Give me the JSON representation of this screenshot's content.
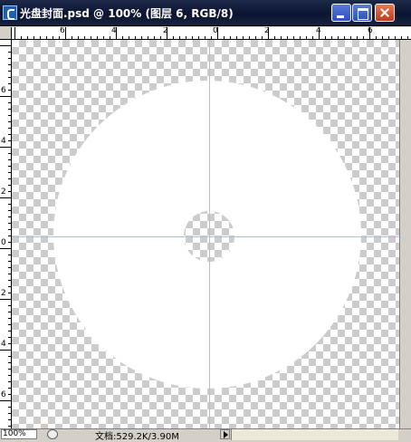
{
  "window": {
    "title": "光盘封面.psd @ 100% (图层 6, RGB/8)",
    "controls": [
      "minimize-icon",
      "maximize-icon",
      "close-icon"
    ]
  },
  "rulers": {
    "horizontal_labels": [
      "6",
      "4",
      "2",
      "0",
      "2",
      "4",
      "6"
    ],
    "vertical_labels": [
      "6",
      "4",
      "2",
      "0",
      "2",
      "4",
      "6"
    ]
  },
  "status": {
    "zoom": "100%",
    "doc_info": "文档:529.2K/3.90M"
  },
  "colors": {
    "guide": "#5fe6e6",
    "checker": "#cccccc",
    "disc": "#ffffff"
  }
}
